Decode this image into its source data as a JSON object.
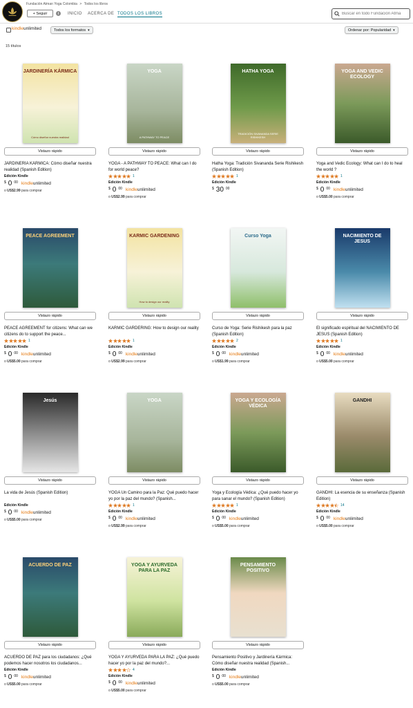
{
  "header": {
    "store_name": "Fundación Atman Yoga Colombia",
    "breadcrumb_sep": ">",
    "breadcrumb_current": "Todos los libros",
    "follow_label": "+ Seguir",
    "info_glyph": "i",
    "nav": [
      "INICIO",
      "ACERCA DE",
      "TODOS LOS LIBROS"
    ],
    "search_placeholder": "Buscar en todo Fundación Atma"
  },
  "filters": {
    "ku_kindle": "kindle",
    "ku_unlimited": "unlimited",
    "formats_label": "Todos los formatos",
    "sort_label": "Ordenar por: Popularidad",
    "caret": "▾"
  },
  "results_count": "15 títulos",
  "labels": {
    "quick_view": "Vistazo rápido",
    "format": "Edición Kindle",
    "currency": "$",
    "alt_prefix": "o",
    "alt_suffix": "para comprar",
    "ku_kindle": "kindle",
    "ku_unlimited": "unlimited"
  },
  "colors": {
    "accent_link": "#007185",
    "kindle_orange": "#e47911",
    "star": "#de7921"
  },
  "products": [
    {
      "title": "JARDINERÍA KÁRMICA: Cómo diseñar nuestra realidad (Spanish Edition)",
      "cover_text": "JARDINERÍA KÁRMICA",
      "cover_sub": "Cómo diseñar nuestra realidad",
      "cover_theme": "karmic",
      "rating": 0,
      "reviews": "",
      "price_whole": "0",
      "price_cents": "00",
      "ku": true,
      "alt_price": "US$2.99"
    },
    {
      "title": "YOGA - A PATHWAY TO PEACE: What can I do for world peace?",
      "cover_text": "YOGA",
      "cover_sub": "A PATHWAY TO PEACE",
      "cover_theme": "yoga",
      "rating": 5,
      "reviews": "1",
      "price_whole": "0",
      "price_cents": "00",
      "ku": true,
      "alt_price": "US$2.99"
    },
    {
      "title": "Hatha Yoga: Tradición Sivananda Serie Rishikesh (Spanish Edition)",
      "cover_text": "HATHA YOGA",
      "cover_sub": "TRADICIÓN SIVANANDA SERIE RISHIKESH",
      "cover_theme": "hatha",
      "rating": 5,
      "reviews": "1",
      "price_whole": "30",
      "price_cents": "00",
      "ku": false,
      "alt_price": ""
    },
    {
      "title": "Yoga and Vedic Ecology: What can I do to heal the world ?",
      "cover_text": "YOGA AND VEDIC ECOLOGY",
      "cover_sub": "",
      "cover_theme": "vedic",
      "rating": 5,
      "reviews": "1",
      "price_whole": "0",
      "price_cents": "00",
      "ku": true,
      "alt_price": "US$5.00"
    },
    {
      "title": "PEACE AGREEMENT for citizens: What can we citizens do to support the peace...",
      "cover_text": "PEACE AGREEMENT",
      "cover_sub": "",
      "cover_theme": "lotus",
      "rating": 5,
      "reviews": "1",
      "price_whole": "0",
      "price_cents": "00",
      "ku": true,
      "alt_price": "US$5.00"
    },
    {
      "title": "KARMIC GARDERING: How to design our reality",
      "cover_text": "KARMIC GARDENING",
      "cover_sub": "How to design our reality",
      "cover_theme": "karmic",
      "rating": 5,
      "reviews": "1",
      "price_whole": "0",
      "price_cents": "00",
      "ku": true,
      "alt_price": "US$2.99"
    },
    {
      "title": "Curso de Yoga: Serie Rishikesh para la paz (Spanish Edition)",
      "cover_text": "Curso Yoga",
      "cover_sub": "",
      "cover_theme": "curso",
      "rating": 5,
      "reviews": "2",
      "price_whole": "0",
      "price_cents": "00",
      "ku": true,
      "alt_price": "US$1.99"
    },
    {
      "title": "El significado espiritual del NACIMIENTO DE JESUS (Spanish Edition)",
      "cover_text": "NACIMIENTO DE JESUS",
      "cover_sub": "",
      "cover_theme": "nacimiento",
      "rating": 5,
      "reviews": "1",
      "price_whole": "0",
      "price_cents": "00",
      "ku": true,
      "alt_price": "US$5.00"
    },
    {
      "title": "La vida de Jesús (Spanish Edition)",
      "cover_text": "Jesús",
      "cover_sub": "",
      "cover_theme": "jesus",
      "rating": 0,
      "reviews": "",
      "price_whole": "0",
      "price_cents": "00",
      "ku": true,
      "alt_price": "US$5.00"
    },
    {
      "title": "YOGA Un Camino para la Paz: Qué puedo hacer yo por la paz del mundo? (Spanish...",
      "cover_text": "YOGA",
      "cover_sub": "",
      "cover_theme": "yoga",
      "rating": 5,
      "reviews": "1",
      "price_whole": "0",
      "price_cents": "00",
      "ku": true,
      "alt_price": "US$2.99"
    },
    {
      "title": "Yoga y Ecología Védica: ¿Qué puedo hacer yo para sanar el mundo? (Spanish Edition)",
      "cover_text": "YOGA Y ECOLOGÍA VÉDICA",
      "cover_sub": "",
      "cover_theme": "vedic",
      "rating": 5,
      "reviews": "1",
      "price_whole": "0",
      "price_cents": "00",
      "ku": true,
      "alt_price": "US$5.00"
    },
    {
      "title": "GANDHI: La esencia de su enseñanza (Spanish Edition)",
      "cover_text": "GANDHI",
      "cover_sub": "",
      "cover_theme": "gandhi",
      "rating": 4.5,
      "reviews": "14",
      "price_whole": "0",
      "price_cents": "00",
      "ku": true,
      "alt_price": "US$5.00"
    },
    {
      "title": "ACUERDO DE PAZ para los ciudadanos: ¿Qué podemos hacer nosotros los ciudadanos...",
      "cover_text": "ACUERDO DE PAZ",
      "cover_sub": "",
      "cover_theme": "lotus",
      "rating": 0,
      "reviews": "",
      "price_whole": "0",
      "price_cents": "00",
      "ku": true,
      "alt_price": "US$5.00"
    },
    {
      "title": "YOGA Y AYURVEDA PARA LA PAZ: ¿Qué puedo hacer yo por la paz del mundo?...",
      "cover_text": "YOGA Y AYURVEDA PARA LA PAZ",
      "cover_sub": "",
      "cover_theme": "ayurveda",
      "rating": 4,
      "reviews": "4",
      "price_whole": "0",
      "price_cents": "00",
      "ku": true,
      "alt_price": "US$5.00"
    },
    {
      "title": "Pensamiento Positivo y Jardinería Kármica: Cómo diseñar nuestra realidad (Spanish...",
      "cover_text": "PENSAMIENTO POSITIVO",
      "cover_sub": "",
      "cover_theme": "pensamiento",
      "rating": 0,
      "reviews": "",
      "price_whole": "0",
      "price_cents": "00",
      "ku": true,
      "alt_price": "US$5.00"
    }
  ]
}
